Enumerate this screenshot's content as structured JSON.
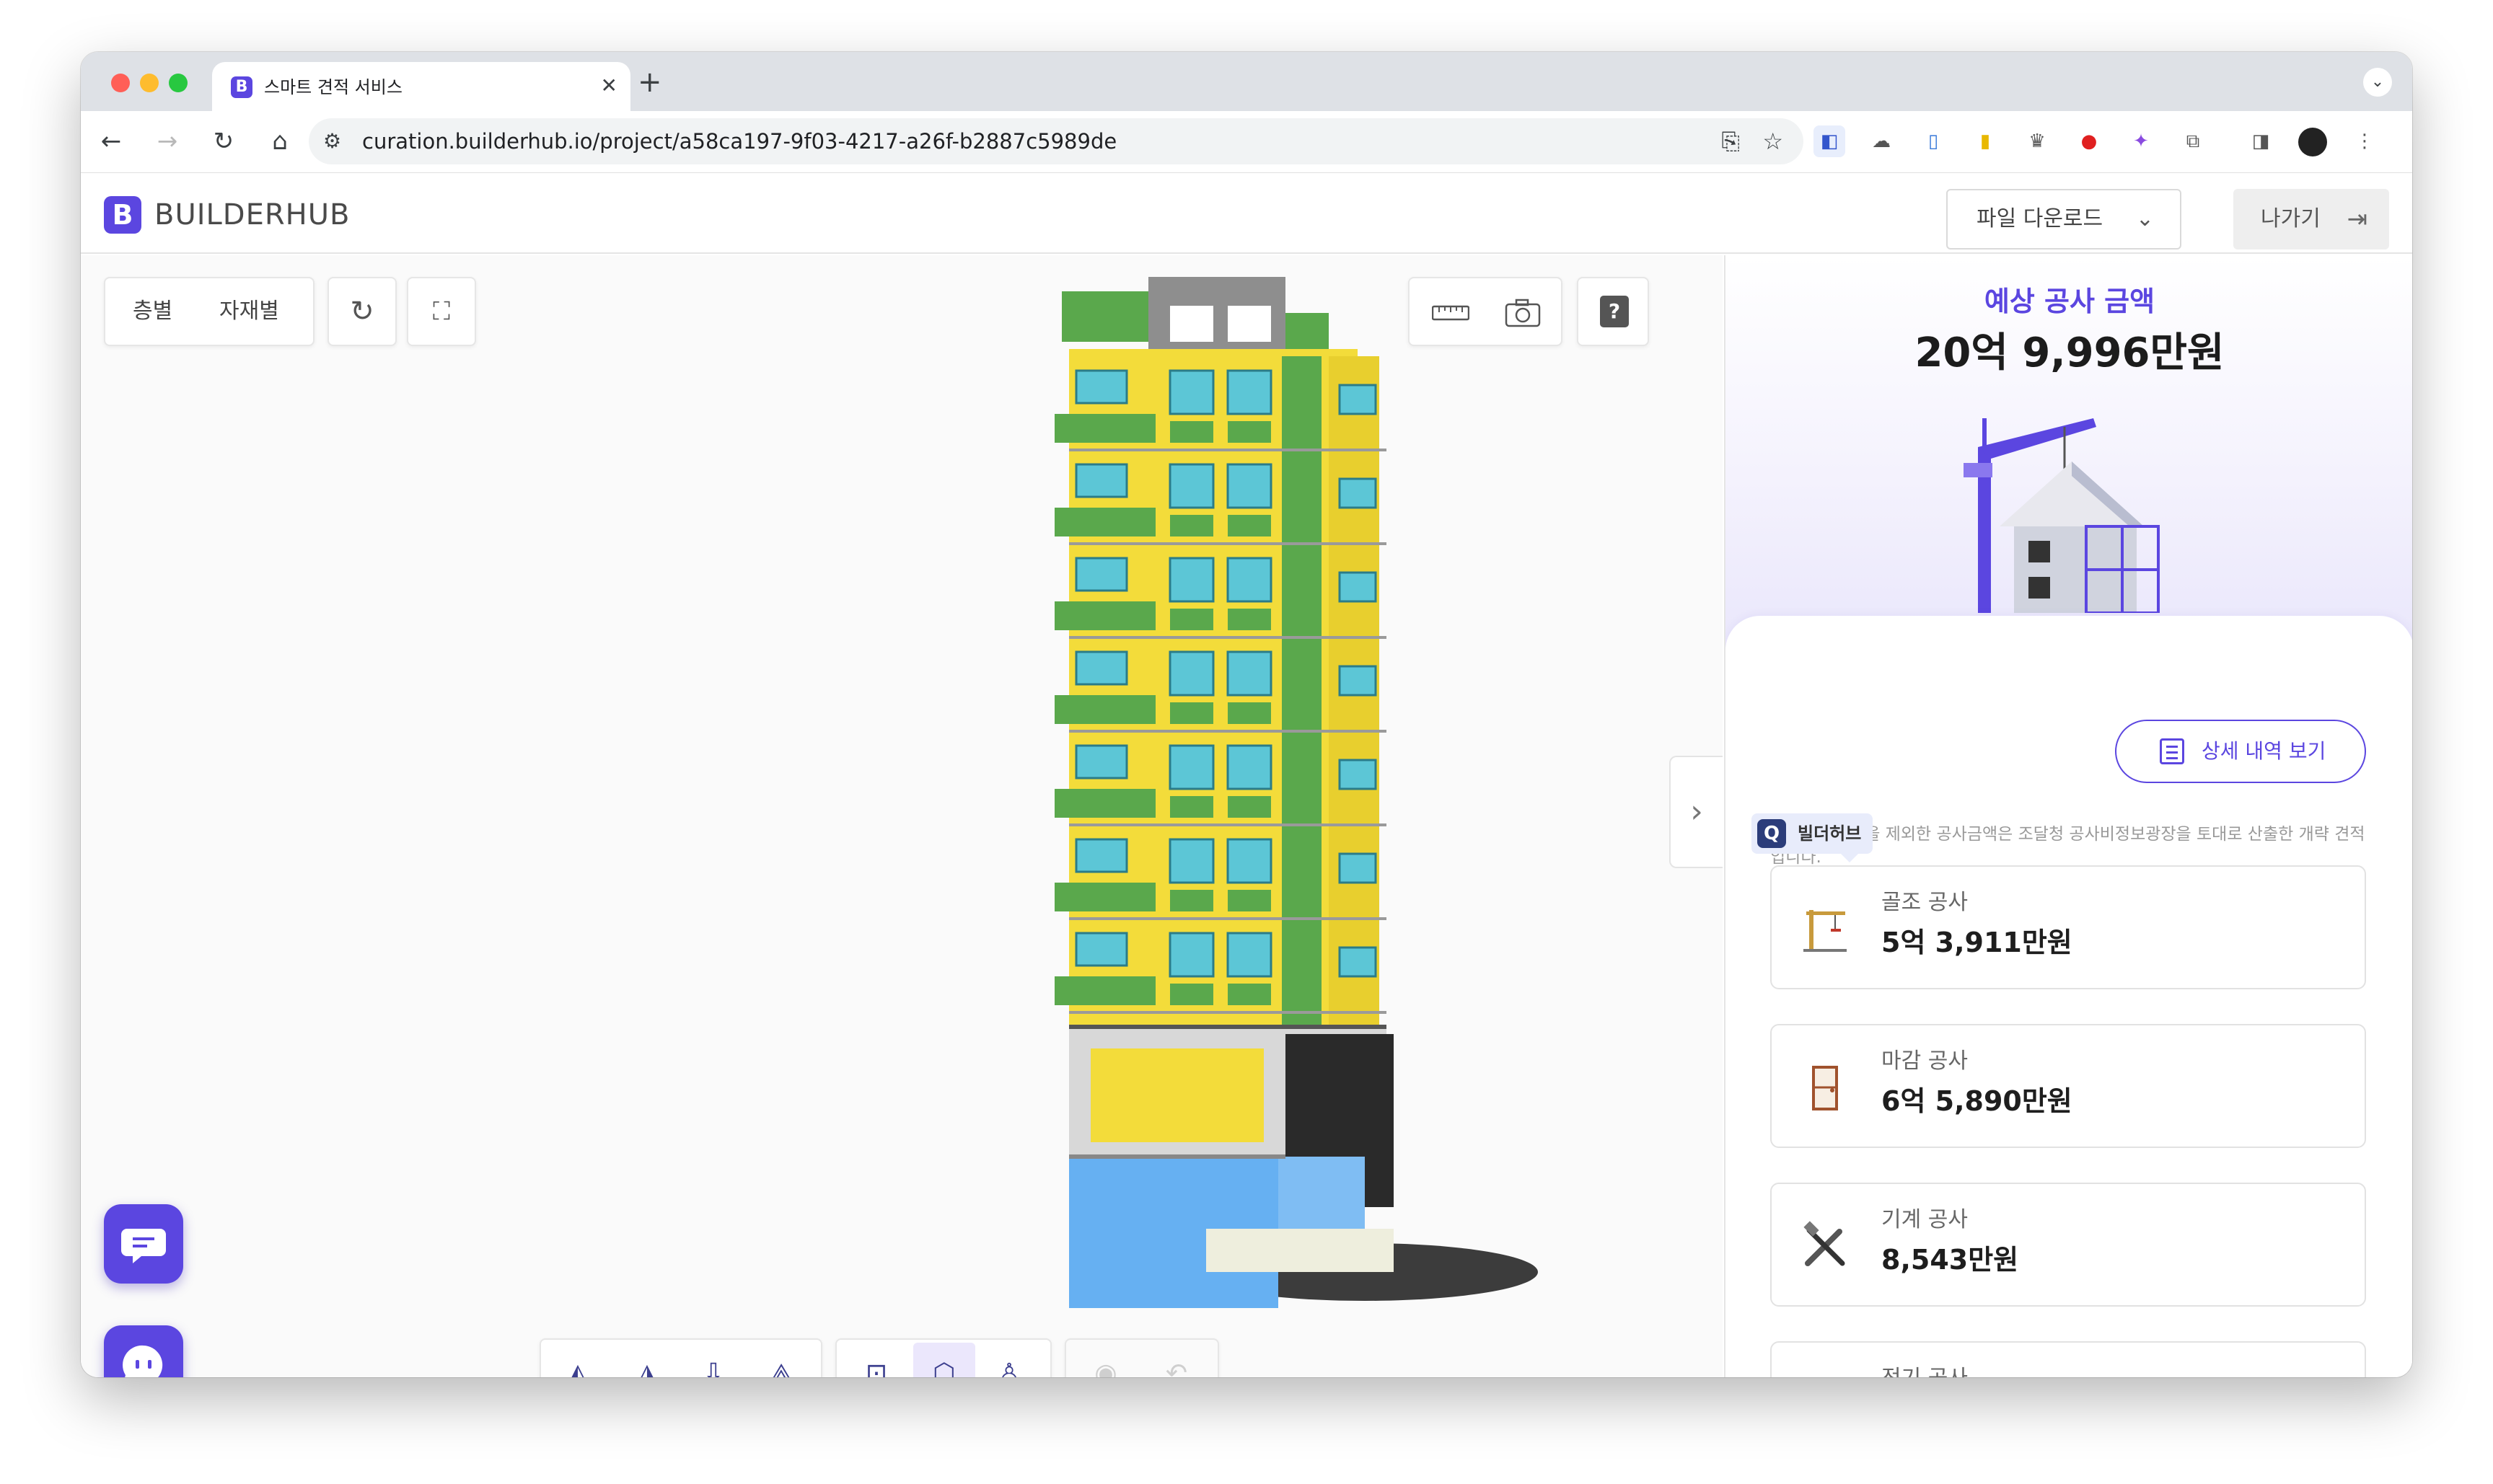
{
  "browser": {
    "tab_title": "스마트 견적 서비스",
    "favicon_letter": "B",
    "url": "curation.builderhub.io/project/a58ca197-9f03-4217-a26f-b2887c5989de"
  },
  "header": {
    "logo_letter": "B",
    "logo_text": "BUILDERHUB",
    "download_label": "파일 다운로드",
    "exit_label": "나가기"
  },
  "viewer": {
    "view_toggle": {
      "floor": "층별",
      "material": "자재별"
    },
    "tools": [
      "reset-icon",
      "fit-view-icon",
      "ruler-icon",
      "camera-icon",
      "help-icon"
    ],
    "bottom_tools": {
      "views": [
        "view-front-icon",
        "view-side-icon",
        "view-top-icon",
        "view-iso-icon"
      ],
      "modes": [
        "section-icon",
        "solid-box-icon",
        "person-icon"
      ],
      "active_mode": "solid-box-icon",
      "visibility": [
        "eye-icon",
        "undo-icon"
      ]
    }
  },
  "panel": {
    "estimate_label": "예상 공사 금액",
    "estimate_value": "20억 9,996만원",
    "detail_button": "상세 내역 보기",
    "note": "골조, 마감을 제외한 공사금액은 조달청 공사비정보광장을 토대로 산출한 개략 견적입니다.",
    "badge": "빌더허브",
    "items": [
      {
        "label": "골조 공사",
        "value": "5억 3,911만원",
        "icon": "crane-icon"
      },
      {
        "label": "마감 공사",
        "value": "6억 5,890만원",
        "icon": "door-icon"
      },
      {
        "label": "기계 공사",
        "value": "8,543만원",
        "icon": "tools-icon"
      },
      {
        "label": "전기 공사",
        "value": "",
        "icon": "electric-icon"
      }
    ]
  },
  "colors": {
    "brand": "#5b46e0",
    "building_yellow": "#f3dc3a",
    "building_green": "#5aa84c",
    "building_blue": "#66b0f2",
    "building_dark": "#2a2a2a"
  }
}
